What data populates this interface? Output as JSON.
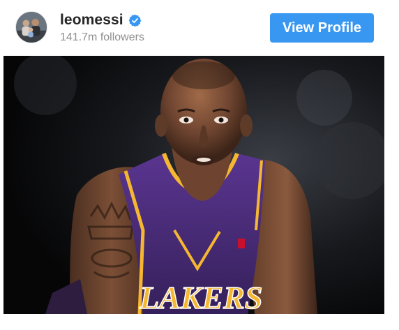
{
  "post": {
    "username": "leomessi",
    "followers": "141.7m followers",
    "view_profile_label": "View Profile",
    "verified": true
  },
  "colors": {
    "accent": "#3897f0",
    "username": "#262626",
    "muted": "#8e8e8e",
    "jersey_purple": "#4b2a7b",
    "jersey_gold": "#f5b731"
  },
  "photo": {
    "jersey_text": "LAKERS"
  },
  "icons": {
    "verified": "verified-badge-icon"
  }
}
